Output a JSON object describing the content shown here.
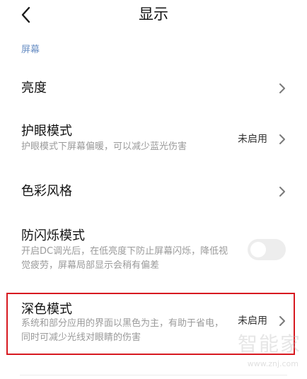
{
  "header": {
    "title": "显示",
    "back_icon": "chevron-left-icon"
  },
  "section": {
    "label": "屏幕"
  },
  "rows": {
    "brightness": {
      "title": "亮度"
    },
    "eyecare": {
      "title": "护眼模式",
      "desc": "护眼模式下屏幕偏暖，可以减少蓝光伤害",
      "value": "未启用"
    },
    "colorstyle": {
      "title": "色彩风格"
    },
    "antiflicker": {
      "title": "防闪烁模式",
      "desc": "开启DC调光后，在低亮度下防止屏幕闪烁，降低视觉疲劳，屏幕局部显示会稍有偏差",
      "enabled": false
    },
    "darkmode": {
      "title": "深色模式",
      "desc": "系统和部分应用的界面以黑色为主，有助于省电，同时可减少光线对眼睛的伤害",
      "value": "未启用"
    }
  },
  "annotation": {
    "highlight_color": "#d71920"
  },
  "watermark": {
    "text": "智能家",
    "url": "www.znj.com"
  },
  "colors": {
    "section_label": "#6a8fc4",
    "toggle_off": "#ededed"
  }
}
